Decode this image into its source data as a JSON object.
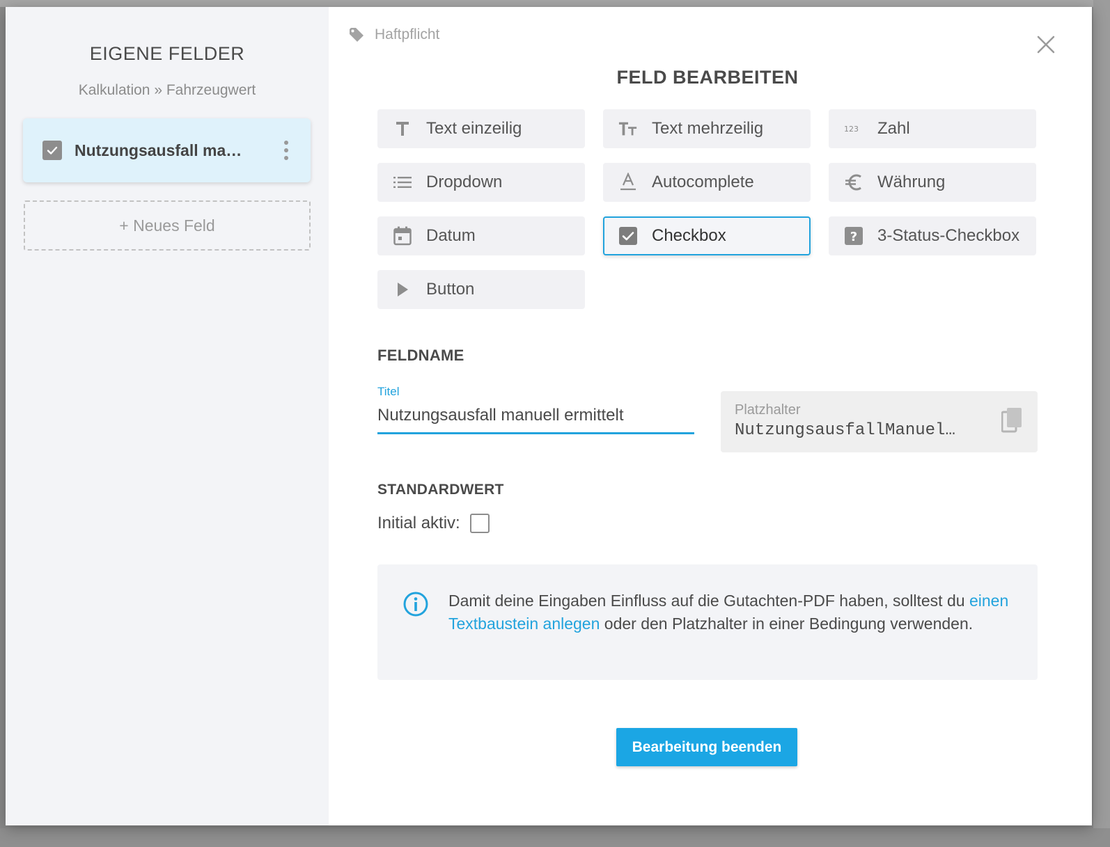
{
  "sidebar": {
    "title": "EIGENE FELDER",
    "breadcrumb": "Kalkulation » Fahrzeugwert",
    "field_card_label": "Nutzungsausfall ma…",
    "new_field_label": "+ Neues Feld"
  },
  "main": {
    "tag_label": "Haftpflicht",
    "title": "FELD BEARBEITEN",
    "types": [
      {
        "label": "Text einzeilig",
        "icon": "text-single-icon"
      },
      {
        "label": "Text mehrzeilig",
        "icon": "text-multi-icon"
      },
      {
        "label": "Zahl",
        "icon": "number-icon"
      },
      {
        "label": "Dropdown",
        "icon": "list-icon"
      },
      {
        "label": "Autocomplete",
        "icon": "autocomplete-icon"
      },
      {
        "label": "Währung",
        "icon": "euro-icon"
      },
      {
        "label": "Datum",
        "icon": "calendar-icon"
      },
      {
        "label": "Checkbox",
        "icon": "checkbox-icon"
      },
      {
        "label": "3-Status-Checkbox",
        "icon": "question-box-icon"
      },
      {
        "label": "Button",
        "icon": "play-icon"
      }
    ],
    "selected_type": "Checkbox",
    "feldname_heading": "FELDNAME",
    "titel_label": "Titel",
    "titel_value": "Nutzungsausfall manuell ermittelt",
    "platzhalter_label": "Platzhalter",
    "platzhalter_value": "NutzungsausfallManuel…",
    "standardwert_heading": "STANDARDWERT",
    "initial_aktiv_label": "Initial aktiv:",
    "info_text_before": "Damit deine Eingaben Einfluss auf die Gutachten-PDF haben, solltest du ",
    "info_link": "einen Textbaustein anlegen",
    "info_text_after": " oder den Platzhalter in einer Bedingung verwenden.",
    "done_button": "Bearbeitung beenden"
  },
  "colors": {
    "accent": "#22a3dd",
    "button": "#1ba6e4",
    "selected_card": "#dff2fb"
  }
}
